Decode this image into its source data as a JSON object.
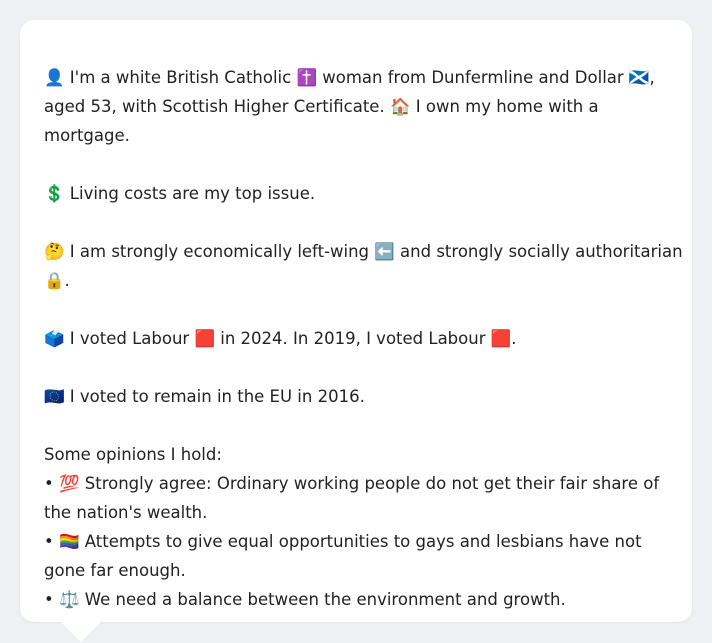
{
  "persona": {
    "identity_lines": [
      "👤 I'm a white British Catholic ✝️ woman from Dunfermline and Dollar 🏴󠁧󠁢󠁳󠁣󠁴󠁿,",
      "aged 53, with Scottish Higher Certificate. 🏠 I own my home with a",
      "mortgage."
    ],
    "top_issue": "💲 Living costs are my top issue.",
    "ideology_lines": [
      "🤔 I am strongly economically left-wing ⬅️ and strongly socially authoritarian",
      "🔒."
    ],
    "vote_history": "🗳️ I voted Labour 🟥 in 2024. In 2019, I voted Labour 🟥.",
    "eu_vote": "🇪🇺 I voted to remain in the EU in 2016.",
    "opinions_header": "Some opinions I hold:",
    "opinions": [
      {
        "lines": [
          "• 💯 Strongly agree: Ordinary working people do not get their fair share of",
          "the nation's wealth."
        ]
      },
      {
        "lines": [
          "• 🏳️‍🌈 Attempts to give equal opportunities to gays and lesbians have not",
          "gone far enough."
        ]
      },
      {
        "lines": [
          "• ⚖️ We need a balance between the environment and growth."
        ]
      }
    ]
  }
}
